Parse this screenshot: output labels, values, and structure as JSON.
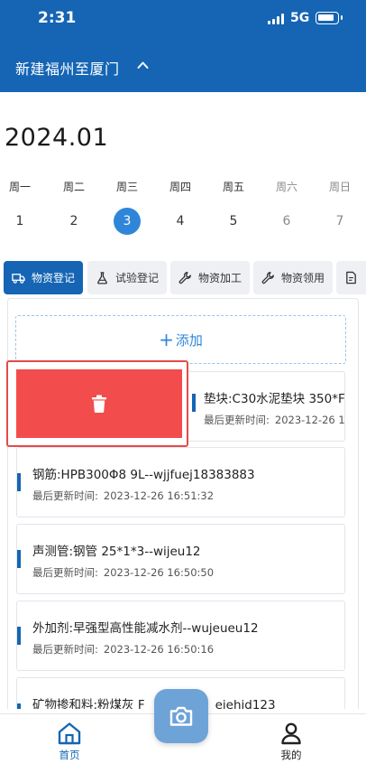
{
  "status_bar": {
    "time": "2:31",
    "network": "5G"
  },
  "header": {
    "project": "新建福州至厦门"
  },
  "calendar": {
    "month": "2024.01",
    "days": [
      {
        "weekday": "周一",
        "date": "1"
      },
      {
        "weekday": "周二",
        "date": "2"
      },
      {
        "weekday": "周三",
        "date": "3",
        "selected": true
      },
      {
        "weekday": "周四",
        "date": "4"
      },
      {
        "weekday": "周五",
        "date": "5"
      },
      {
        "weekday": "周六",
        "date": "6"
      },
      {
        "weekday": "周日",
        "date": "7"
      }
    ]
  },
  "tabs": [
    {
      "label": "物资登记",
      "icon": "truck-icon",
      "active": true
    },
    {
      "label": "试验登记",
      "icon": "flask-icon"
    },
    {
      "label": "物资加工",
      "icon": "wrench-icon"
    },
    {
      "label": "物资领用",
      "icon": "wrench-icon"
    },
    {
      "label": "",
      "icon": "document-icon"
    }
  ],
  "add_label": "添加",
  "records": [
    {
      "title": "垫块:C30水泥垫块 350*F",
      "updated_label": "最后更新时间:",
      "updated": "2023-12-26 1"
    },
    {
      "title": "钢筋:HPB300Φ8 9L--wjjfuej18383883",
      "updated_label": "最后更新时间:",
      "updated": "2023-12-26 16:51:32"
    },
    {
      "title": "声测管:钢管 25*1*3--wijeu12",
      "updated_label": "最后更新时间:",
      "updated": "2023-12-26 16:50:50"
    },
    {
      "title": "外加剂:早强型高性能减水剂--wujeueu12",
      "updated_label": "最后更新时间:",
      "updated": "2023-12-26 16:50:16"
    },
    {
      "title": "矿物掺和料:粉煤灰 F",
      "title_tail": "eiehid123"
    }
  ],
  "nav": {
    "home": "首页",
    "mine": "我的"
  },
  "colors": {
    "primary": "#1565b4",
    "accent": "#2f86d9",
    "delete": "#f24c4c",
    "camera": "#6ea3d8"
  }
}
